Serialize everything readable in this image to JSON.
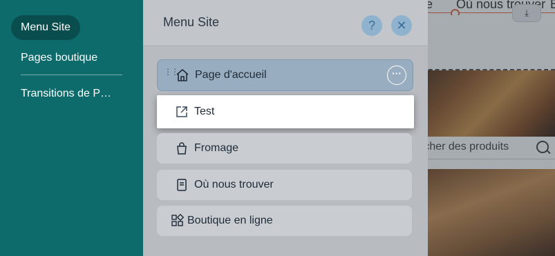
{
  "left_panel": {
    "items": [
      {
        "label": "Menu Site",
        "active": true
      },
      {
        "label": "Pages boutique",
        "active": false
      },
      {
        "label": "Transitions de P…",
        "active": false
      }
    ]
  },
  "menu_panel": {
    "title": "Menu Site",
    "help_label": "?",
    "close_label": "✕",
    "more_label": "···",
    "pages": [
      {
        "label": "Page d'accueil",
        "icon": "home-icon",
        "state": "selected"
      },
      {
        "label": "Test",
        "icon": "external-link-icon",
        "state": "dragging"
      },
      {
        "label": "Fromage",
        "icon": "shopping-bag-icon",
        "state": "normal"
      },
      {
        "label": "Où nous trouver",
        "icon": "document-icon",
        "state": "normal"
      },
      {
        "label": "Boutique en ligne",
        "icon": "grid-icon",
        "state": "normal"
      }
    ]
  },
  "site_preview": {
    "nav_items": [
      "ge",
      "Où nous trouver",
      "B"
    ],
    "download_label": "⤓",
    "search_placeholder": "rcher des produits"
  },
  "colors": {
    "left_panel": "#0d6b6b",
    "selected_row": "#98adc0",
    "nav_accent": "#e45c3a"
  }
}
